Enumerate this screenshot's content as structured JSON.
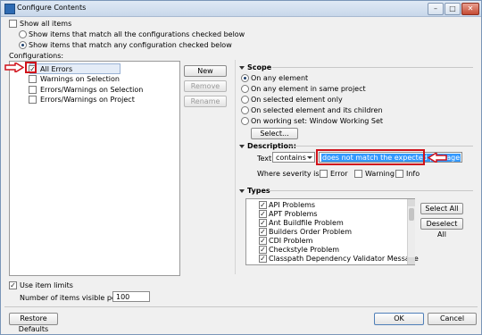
{
  "window": {
    "title": "Configure Contents",
    "controls": {
      "minimize": "–",
      "maximize": "□",
      "close": "✕"
    }
  },
  "show_all_items": {
    "label": "Show all items",
    "checked": false
  },
  "scope_radios": [
    {
      "label": "Show items that match all the configurations checked below",
      "selected": false
    },
    {
      "label": "Show items that match any configuration checked below",
      "selected": true
    }
  ],
  "configurations": {
    "label": "Configurations:",
    "items": [
      {
        "label": "All Errors",
        "checked": true
      },
      {
        "label": "Warnings on Selection",
        "checked": false
      },
      {
        "label": "Errors/Warnings on Selection",
        "checked": false
      },
      {
        "label": "Errors/Warnings on Project",
        "checked": false
      }
    ],
    "buttons": {
      "new": "New",
      "remove": "Remove",
      "rename": "Rename"
    }
  },
  "scope": {
    "title": "Scope",
    "options": [
      {
        "label": "On any element",
        "selected": true
      },
      {
        "label": "On any element in same project",
        "selected": false
      },
      {
        "label": "On selected element only",
        "selected": false
      },
      {
        "label": "On selected element and its children",
        "selected": false
      },
      {
        "label": "On working set:  Window Working Set",
        "selected": false
      }
    ],
    "select_button": "Select..."
  },
  "description": {
    "title": "Description:",
    "text_label": "Text:",
    "operator": "contains",
    "value": "does not match the expected package",
    "severity_label": "Where severity is:",
    "severities": [
      {
        "label": "Error",
        "checked": true
      },
      {
        "label": "Warning",
        "checked": false
      },
      {
        "label": "Info",
        "checked": false
      }
    ]
  },
  "types": {
    "title": "Types",
    "items": [
      {
        "label": "API Problems",
        "checked": true
      },
      {
        "label": "APT Problems",
        "checked": true
      },
      {
        "label": "Ant Buildfile Problem",
        "checked": true
      },
      {
        "label": "Builders Order Problem",
        "checked": true
      },
      {
        "label": "CDI Problem",
        "checked": true
      },
      {
        "label": "Checkstyle Problem",
        "checked": true
      },
      {
        "label": "Classpath Dependency Validator Message",
        "checked": true
      }
    ],
    "select_all": "Select All",
    "deselect_all": "Deselect All"
  },
  "limits": {
    "use_item_limits": {
      "label": "Use item limits",
      "checked": true
    },
    "per_group_label": "Number of items visible per group:",
    "per_group_value": "100"
  },
  "footer": {
    "restore_defaults": "Restore Defaults",
    "ok": "OK",
    "cancel": "Cancel"
  },
  "colors": {
    "highlight": "#3399ff",
    "annotation_red": "#d0121b"
  }
}
